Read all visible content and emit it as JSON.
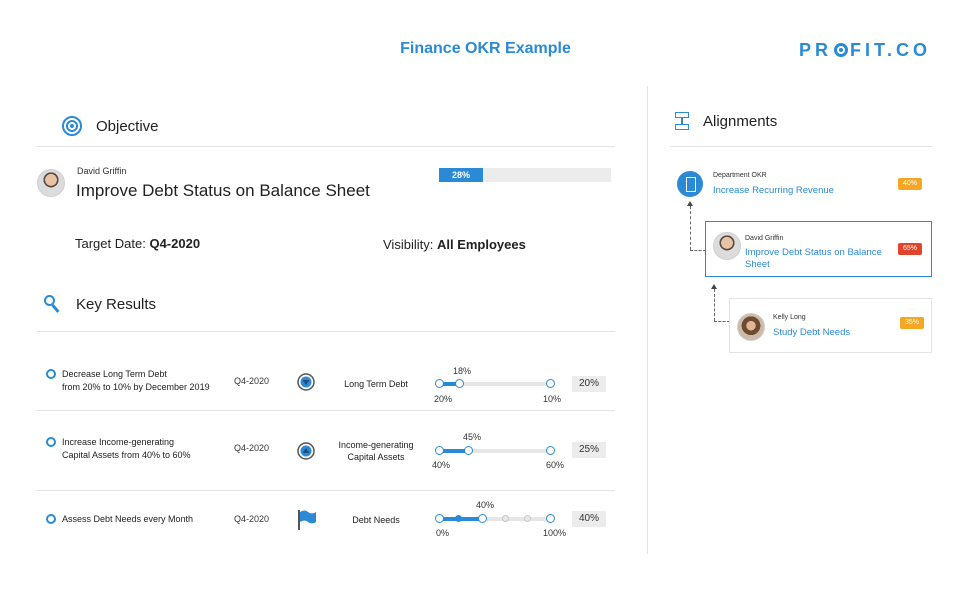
{
  "header": {
    "title": "Finance OKR Example",
    "brand": "PROFIT.CO"
  },
  "objective": {
    "section_label": "Objective",
    "owner": "David Griffin",
    "title": "Improve Debt Status on Balance Sheet",
    "progress_percent": 28,
    "progress_label": "28%",
    "target_date_label": "Target Date:",
    "target_date": "Q4-2020",
    "visibility_label": "Visibility:",
    "visibility": "All Employees"
  },
  "key_results": {
    "section_label": "Key Results",
    "items": [
      {
        "name_line1": "Decrease Long Term Debt",
        "name_line2": "from 20% to 10% by December 2019",
        "date": "Q4-2020",
        "metric_icon": "decrease-triangle-icon",
        "metric_line1": "Long Term Debt",
        "metric_line2": "",
        "current_label": "18%",
        "start_label": "20%",
        "target_label": "10%",
        "progress": "20%"
      },
      {
        "name_line1": "Increase Income-generating",
        "name_line2": "Capital Assets from 40% to 60%",
        "date": "Q4-2020",
        "metric_icon": "increase-triangle-icon",
        "metric_line1": "Income-generating",
        "metric_line2": "Capital Assets",
        "current_label": "45%",
        "start_label": "40%",
        "target_label": "60%",
        "progress": "25%"
      },
      {
        "name_line1": "Assess Debt Needs every Month",
        "name_line2": "",
        "date": "Q4-2020",
        "metric_icon": "flag-icon",
        "metric_line1": "Debt Needs",
        "metric_line2": "",
        "current_label": "40%",
        "start_label": "0%",
        "target_label": "100%",
        "progress": "40%"
      }
    ]
  },
  "alignments": {
    "section_label": "Alignments",
    "items": [
      {
        "owner": "Department OKR",
        "title": "Increase Recurring Revenue",
        "badge": "40%",
        "badge_color": "#f5a623"
      },
      {
        "owner": "David Griffin",
        "title_line1": "Improve Debt Status on Balance",
        "title_line2": "Sheet",
        "badge": "65%",
        "badge_color": "#e0452b"
      },
      {
        "owner": "Kelly Long",
        "title": "Study Debt Needs",
        "badge": "35%",
        "badge_color": "#f5a623"
      }
    ]
  },
  "colors": {
    "accent": "#2b8ad6",
    "orange": "#f5a623",
    "red": "#e0452b"
  }
}
